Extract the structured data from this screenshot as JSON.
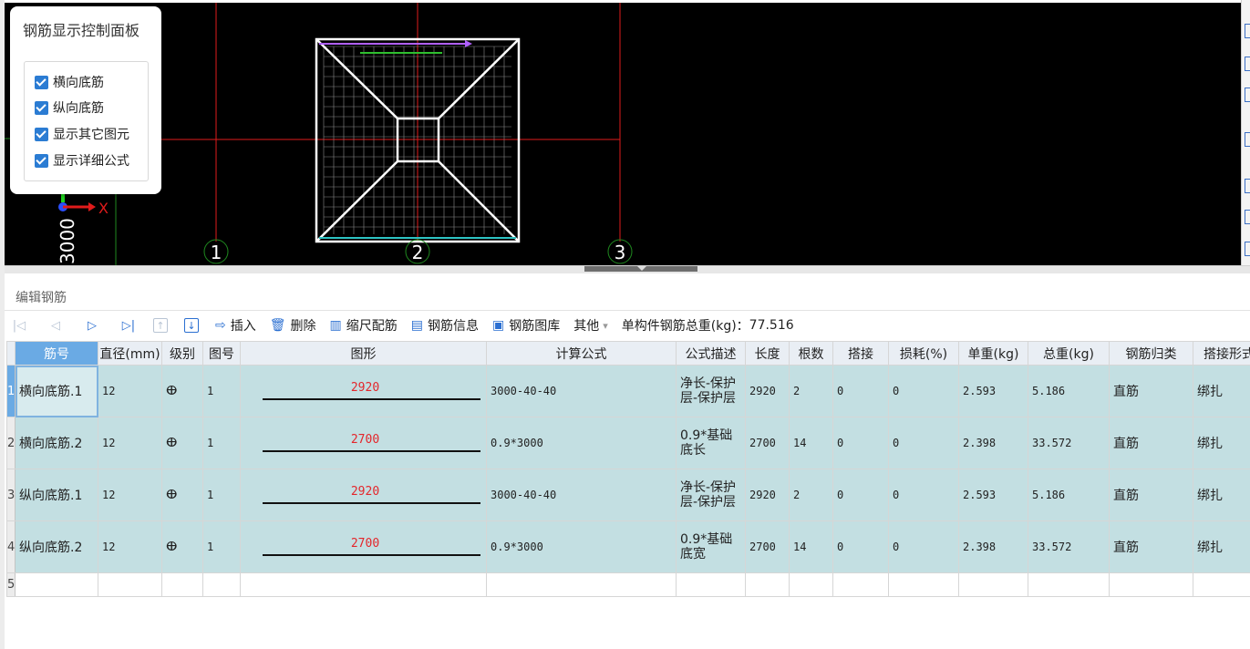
{
  "control_panel": {
    "title": "钢筋显示控制面板",
    "checkboxes": [
      {
        "label": "横向底筋",
        "checked": true
      },
      {
        "label": "纵向底筋",
        "checked": true
      },
      {
        "label": "显示其它图元",
        "checked": true
      },
      {
        "label": "显示详细公式",
        "checked": true
      }
    ]
  },
  "viewport": {
    "axis_labels": [
      "1",
      "2",
      "3"
    ],
    "dimension_label": "3000",
    "x_axis_label": "X",
    "colors": {
      "background": "#000000",
      "axis_line": "#e01b1b",
      "grid_line": "#1f8a1f",
      "rebar": "#ffffff"
    }
  },
  "editor": {
    "title": "编辑钢筋",
    "toolbar": {
      "insert": "插入",
      "delete": "删除",
      "scale": "缩尺配筋",
      "rebar_info": "钢筋信息",
      "rebar_library": "钢筋图库",
      "other": "其他",
      "other_arrow": "▾",
      "total_weight_label": "单构件钢筋总重(kg)：",
      "total_weight_value": "77.516"
    },
    "columns": [
      "筋号",
      "直径(mm)",
      "级别",
      "图号",
      "图形",
      "计算公式",
      "公式描述",
      "长度",
      "根数",
      "搭接",
      "损耗(%)",
      "单重(kg)",
      "总重(kg)",
      "钢筋归类",
      "搭接形式"
    ],
    "rows": [
      {
        "num": "1",
        "name": "横向底筋.1",
        "diameter": "12",
        "grade": "ⴲ",
        "fig": "1",
        "shape_value": "2920",
        "formula": "3000-40-40",
        "desc": "净长-保护层-保护层",
        "length": "2920",
        "count": "2",
        "lap": "0",
        "loss": "0",
        "unit_weight": "2.593",
        "total_weight": "5.186",
        "category": "直筋",
        "lap_type": "绑扎"
      },
      {
        "num": "2",
        "name": "横向底筋.2",
        "diameter": "12",
        "grade": "ⴲ",
        "fig": "1",
        "shape_value": "2700",
        "formula": "0.9*3000",
        "desc": "0.9*基础底长",
        "length": "2700",
        "count": "14",
        "lap": "0",
        "loss": "0",
        "unit_weight": "2.398",
        "total_weight": "33.572",
        "category": "直筋",
        "lap_type": "绑扎"
      },
      {
        "num": "3",
        "name": "纵向底筋.1",
        "diameter": "12",
        "grade": "ⴲ",
        "fig": "1",
        "shape_value": "2920",
        "formula": "3000-40-40",
        "desc": "净长-保护层-保护层",
        "length": "2920",
        "count": "2",
        "lap": "0",
        "loss": "0",
        "unit_weight": "2.593",
        "total_weight": "5.186",
        "category": "直筋",
        "lap_type": "绑扎"
      },
      {
        "num": "4",
        "name": "纵向底筋.2",
        "diameter": "12",
        "grade": "ⴲ",
        "fig": "1",
        "shape_value": "2700",
        "formula": "0.9*3000",
        "desc": "0.9*基础底宽",
        "length": "2700",
        "count": "14",
        "lap": "0",
        "loss": "0",
        "unit_weight": "2.398",
        "total_weight": "33.572",
        "category": "直筋",
        "lap_type": "绑扎"
      }
    ],
    "empty_row_num": "5"
  }
}
